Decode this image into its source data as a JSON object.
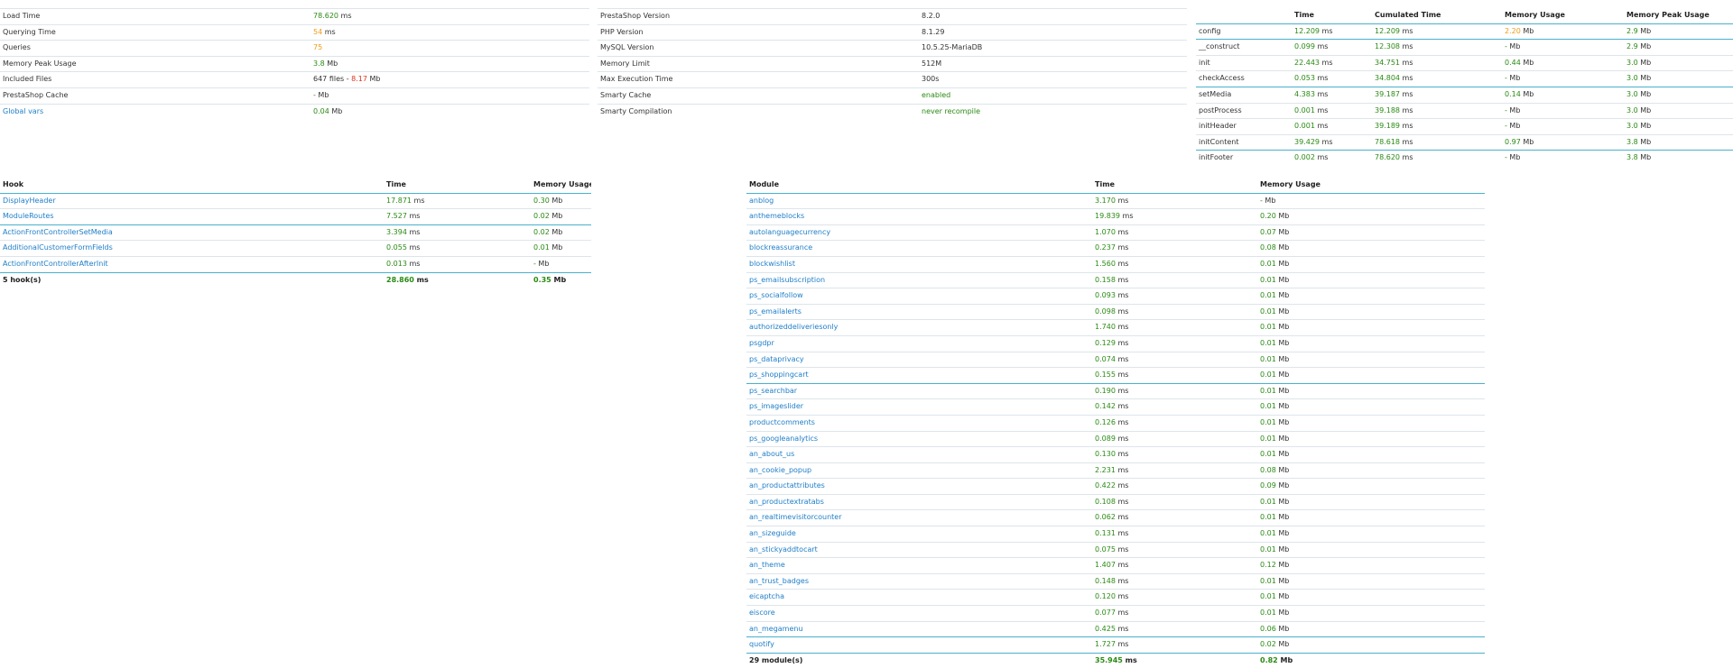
{
  "summary": [
    {
      "label": "Load Time",
      "value": "78.620",
      "unit": " ms",
      "color": "g"
    },
    {
      "label": "Querying Time",
      "value": "54",
      "unit": " ms",
      "color": "o"
    },
    {
      "label": "Queries",
      "value": "75",
      "unit": "",
      "color": "o"
    },
    {
      "label": "Memory Peak Usage",
      "value": "3.8",
      "unit": " Mb",
      "color": "g"
    },
    {
      "label": "Included Files",
      "value": "647 files - ",
      "value2": "8.17",
      "unit": " Mb",
      "color": "",
      "color2": "r"
    },
    {
      "label": "PrestaShop Cache",
      "value": "-",
      "unit": " Mb",
      "color": "g"
    },
    {
      "label": "Global vars",
      "value": "0.04",
      "unit": " Mb",
      "color": "g",
      "link": true
    }
  ],
  "config": [
    {
      "label": "PrestaShop Version",
      "value": "8.2.0",
      "color": ""
    },
    {
      "label": "PHP Version",
      "value": "8.1.29",
      "color": ""
    },
    {
      "label": "MySQL Version",
      "value": "10.5.25-MariaDB",
      "color": ""
    },
    {
      "label": "Memory Limit",
      "value": "512M",
      "color": ""
    },
    {
      "label": "Max Execution Time",
      "value": "300s",
      "color": ""
    },
    {
      "label": "Smarty Cache",
      "value": "enabled",
      "color": "g"
    },
    {
      "label": "Smarty Compilation",
      "value": "never recompile",
      "color": "g"
    }
  ],
  "steps": {
    "headers": [
      "",
      "Time",
      "Cumulated Time",
      "Memory Usage",
      "Memory Peak Usage"
    ],
    "rows": [
      {
        "name": "config",
        "time": "12.209",
        "cum": "12.209",
        "mem": "2.20",
        "mem_color": "o",
        "peak": "2.9",
        "line": false
      },
      {
        "name": "__construct",
        "time": "0.099",
        "cum": "12.308",
        "mem": "-",
        "mem_color": "g",
        "peak": "2.9",
        "line": true
      },
      {
        "name": "init",
        "time": "22.443",
        "cum": "34.751",
        "mem": "0.44",
        "mem_color": "g",
        "peak": "3.0",
        "line": false
      },
      {
        "name": "checkAccess",
        "time": "0.053",
        "cum": "34.804",
        "mem": "-",
        "mem_color": "g",
        "peak": "3.0",
        "line": false
      },
      {
        "name": "setMedia",
        "time": "4.383",
        "cum": "39.187",
        "mem": "0.14",
        "mem_color": "g",
        "peak": "3.0",
        "line": true
      },
      {
        "name": "postProcess",
        "time": "0.001",
        "cum": "39.188",
        "mem": "-",
        "mem_color": "g",
        "peak": "3.0",
        "line": false
      },
      {
        "name": "initHeader",
        "time": "0.001",
        "cum": "39.189",
        "mem": "-",
        "mem_color": "g",
        "peak": "3.0",
        "line": false
      },
      {
        "name": "initContent",
        "time": "39.429",
        "cum": "78.618",
        "mem": "0.97",
        "mem_color": "g",
        "peak": "3.8",
        "line": false
      },
      {
        "name": "initFooter",
        "time": "0.002",
        "cum": "78.620",
        "mem": "-",
        "mem_color": "g",
        "peak": "3.8",
        "line": true
      }
    ]
  },
  "hooks": {
    "headers": [
      "Hook",
      "Time",
      "Memory Usage"
    ],
    "rows": [
      {
        "name": "DisplayHeader",
        "time": "17.871",
        "mem": "0.30",
        "line": false
      },
      {
        "name": "ModuleRoutes",
        "time": "7.527",
        "mem": "0.02",
        "line": false
      },
      {
        "name": "ActionFrontControllerSetMedia",
        "time": "3.394",
        "mem": "0.02",
        "line": true
      },
      {
        "name": "AdditionalCustomerFormFields",
        "time": "0.055",
        "mem": "0.01",
        "line": false
      },
      {
        "name": "ActionFrontControllerAfterInit",
        "time": "0.013",
        "mem": "-",
        "line": false
      }
    ],
    "total": {
      "label": "5 hook(s)",
      "time": "28.860",
      "mem": "0.35"
    }
  },
  "modules": {
    "headers": [
      "Module",
      "Time",
      "Memory Usage"
    ],
    "rows": [
      {
        "name": "anblog",
        "time": "3.170",
        "mem": "-",
        "line": false
      },
      {
        "name": "anthemeblocks",
        "time": "19.839",
        "mem": "0.20",
        "line": false
      },
      {
        "name": "autolanguagecurrency",
        "time": "1.070",
        "mem": "0.07",
        "line": false
      },
      {
        "name": "blockreassurance",
        "time": "0.237",
        "mem": "0.08",
        "line": false
      },
      {
        "name": "blockwishlist",
        "time": "1.560",
        "mem": "0.01",
        "line": false
      },
      {
        "name": "ps_emailsubscription",
        "time": "0.158",
        "mem": "0.01",
        "line": false
      },
      {
        "name": "ps_socialfollow",
        "time": "0.093",
        "mem": "0.01",
        "line": false
      },
      {
        "name": "ps_emailalerts",
        "time": "0.098",
        "mem": "0.01",
        "line": false
      },
      {
        "name": "authorizeddeliveriesonly",
        "time": "1.740",
        "mem": "0.01",
        "line": false
      },
      {
        "name": "psgdpr",
        "time": "0.129",
        "mem": "0.01",
        "line": false
      },
      {
        "name": "ps_dataprivacy",
        "time": "0.074",
        "mem": "0.01",
        "line": false
      },
      {
        "name": "ps_shoppingcart",
        "time": "0.155",
        "mem": "0.01",
        "line": false
      },
      {
        "name": "ps_searchbar",
        "time": "0.190",
        "mem": "0.01",
        "line": true
      },
      {
        "name": "ps_imageslider",
        "time": "0.142",
        "mem": "0.01",
        "line": false
      },
      {
        "name": "productcomments",
        "time": "0.126",
        "mem": "0.01",
        "line": false
      },
      {
        "name": "ps_googleanalytics",
        "time": "0.089",
        "mem": "0.01",
        "line": false
      },
      {
        "name": "an_about_us",
        "time": "0.130",
        "mem": "0.01",
        "line": false
      },
      {
        "name": "an_cookie_popup",
        "time": "2.231",
        "mem": "0.08",
        "line": false
      },
      {
        "name": "an_productattributes",
        "time": "0.422",
        "mem": "0.09",
        "line": false
      },
      {
        "name": "an_productextratabs",
        "time": "0.108",
        "mem": "0.01",
        "line": false
      },
      {
        "name": "an_realtimevisitorcounter",
        "time": "0.062",
        "mem": "0.01",
        "line": false
      },
      {
        "name": "an_sizeguide",
        "time": "0.131",
        "mem": "0.01",
        "line": false
      },
      {
        "name": "an_stickyaddtocart",
        "time": "0.075",
        "mem": "0.01",
        "line": false
      },
      {
        "name": "an_theme",
        "time": "1.407",
        "mem": "0.12",
        "line": false
      },
      {
        "name": "an_trust_badges",
        "time": "0.148",
        "mem": "0.01",
        "line": false
      },
      {
        "name": "eicaptcha",
        "time": "0.120",
        "mem": "0.01",
        "line": false
      },
      {
        "name": "eiscore",
        "time": "0.077",
        "mem": "0.01",
        "line": false
      },
      {
        "name": "an_megamenu",
        "time": "0.425",
        "mem": "0.06",
        "line": false
      },
      {
        "name": "quotify",
        "time": "1.727",
        "mem": "0.02",
        "line": true
      }
    ],
    "total": {
      "label": "29 module(s)",
      "time": "35.945",
      "mem": "0.82"
    }
  },
  "units": {
    "ms": " ms",
    "mb": " Mb"
  }
}
